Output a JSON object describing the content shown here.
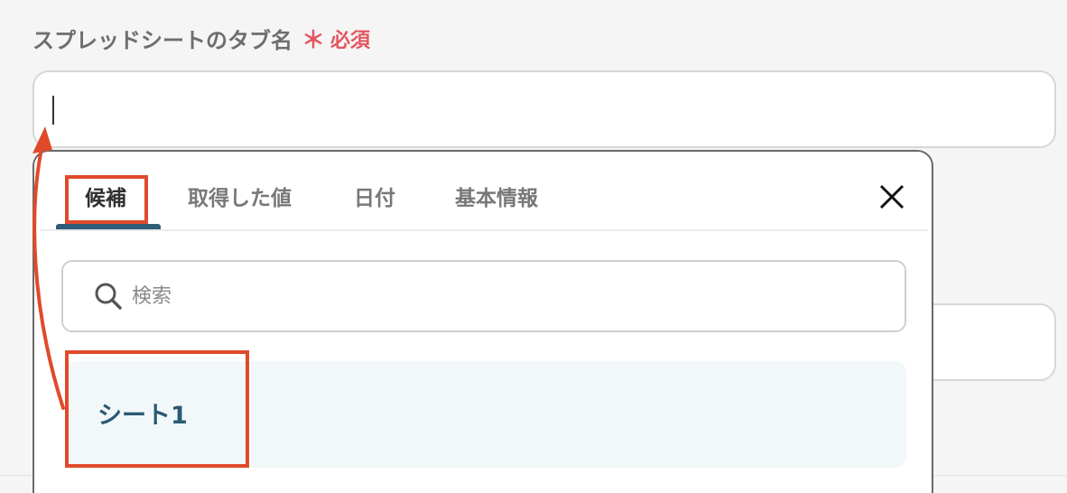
{
  "field": {
    "label": "スプレッドシートのタブ名",
    "required_star": "＊",
    "required_text": "必須",
    "value": ""
  },
  "popup": {
    "tabs": [
      {
        "label": "候補",
        "active": true
      },
      {
        "label": "取得した値",
        "active": false
      },
      {
        "label": "日付",
        "active": false
      },
      {
        "label": "基本情報",
        "active": false
      }
    ],
    "close_icon": "close-icon",
    "search": {
      "placeholder": "検索",
      "icon": "search-icon"
    },
    "options": [
      {
        "label": "シート1"
      }
    ]
  },
  "colors": {
    "required": "#e3565f",
    "tab_active_underline": "#2f5d78",
    "option_text": "#2a5a73",
    "option_bg": "#f2f8f9",
    "annotation_red": "#e04a2b"
  }
}
